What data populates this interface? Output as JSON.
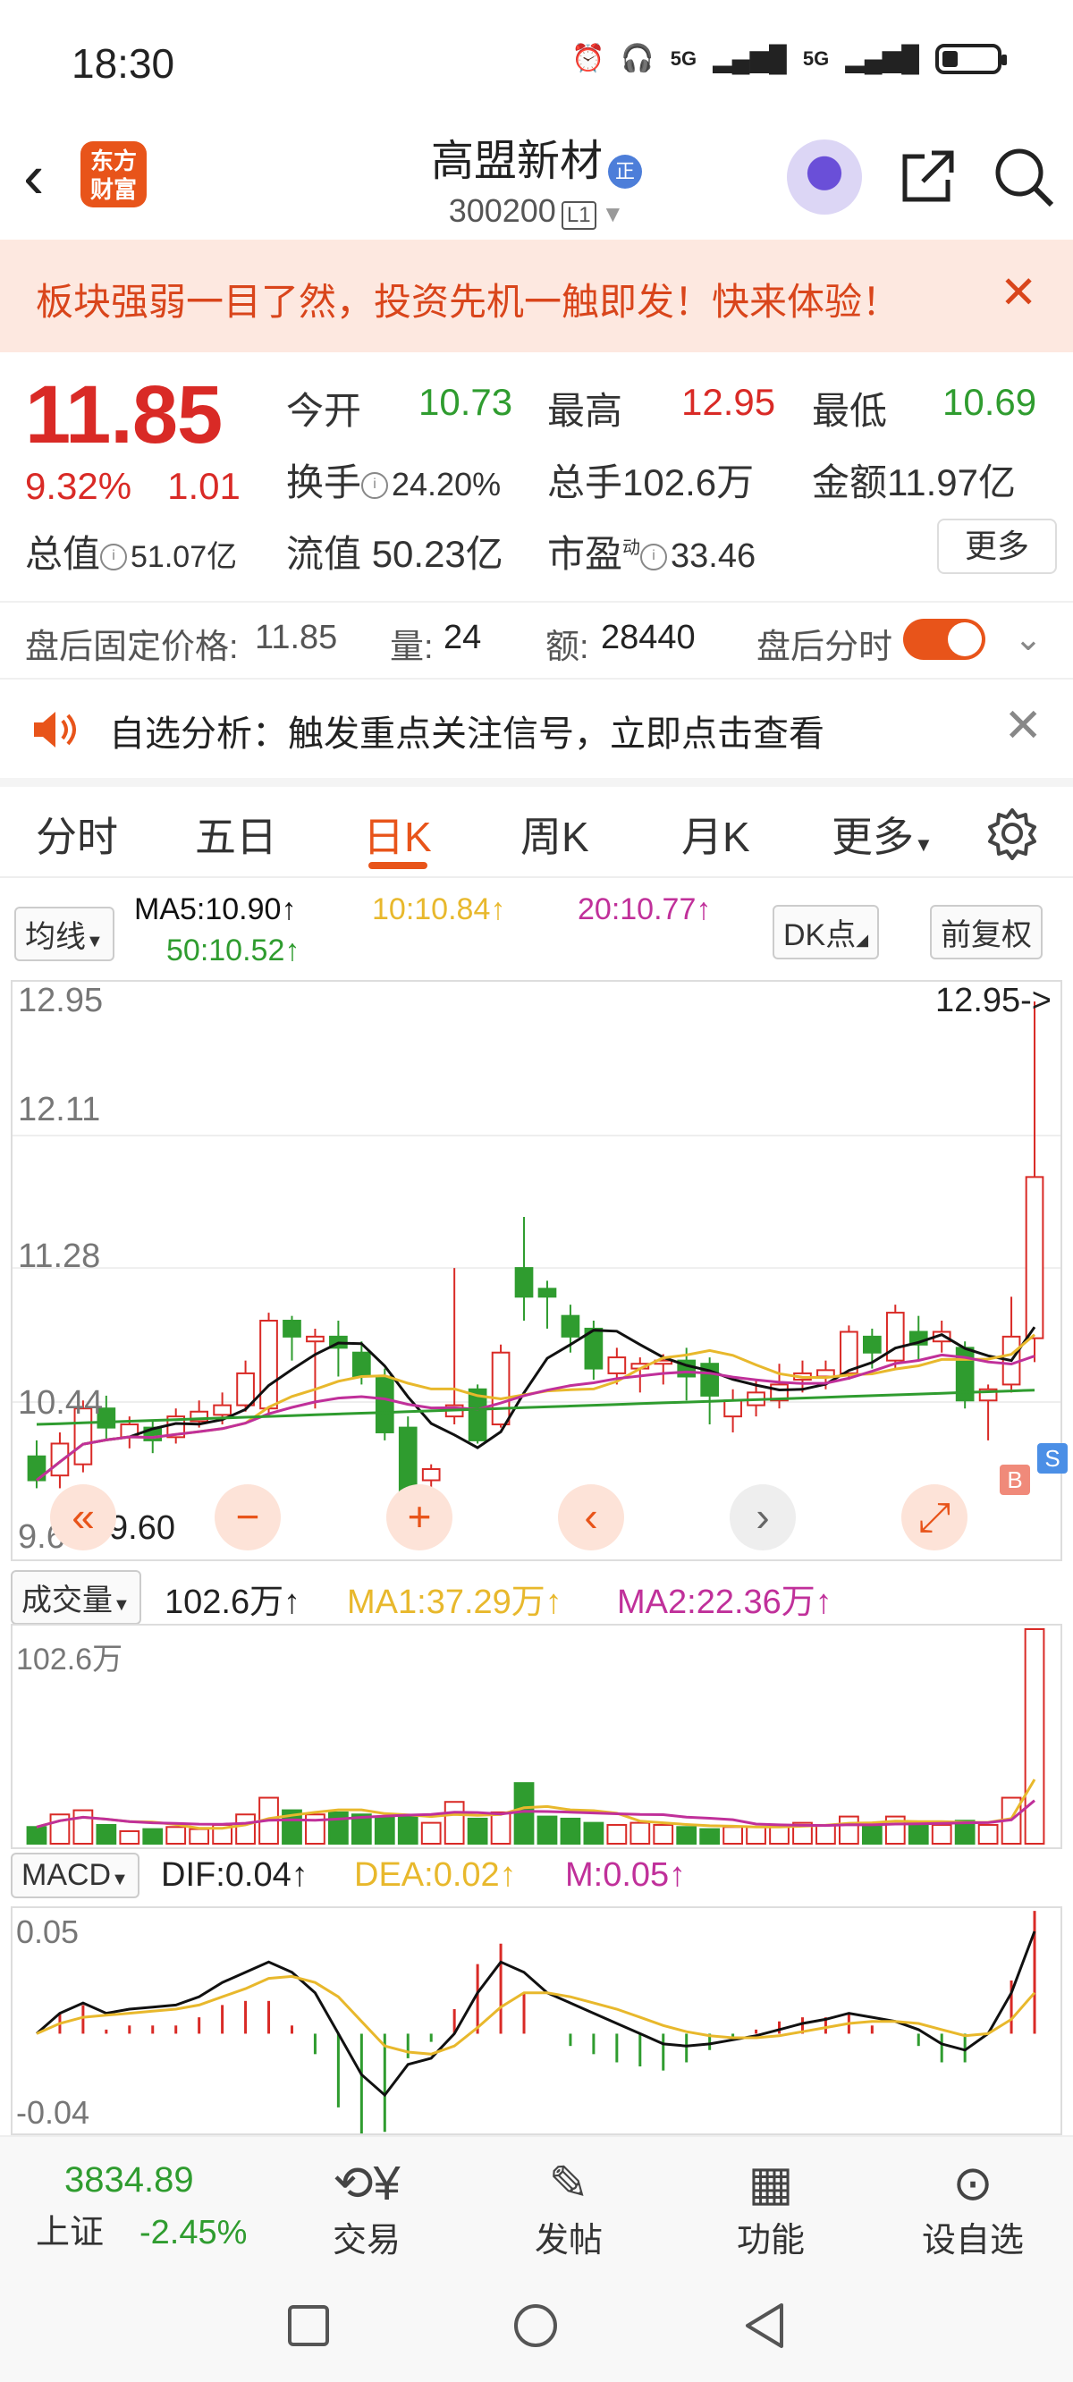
{
  "status_bar": {
    "time": "18:30",
    "signal1": "5G",
    "signal2": "5G",
    "battery_level": 0.25
  },
  "header": {
    "logo_line1": "东方",
    "logo_line2": "财富",
    "stock_name": "高盟新材",
    "badge": "正",
    "stock_code": "300200",
    "level": "L1"
  },
  "banner": {
    "text": "板块强弱一目了然，投资先机一触即发！快来体验！",
    "close": "✕"
  },
  "quote": {
    "price": "11.85",
    "change_pct": "9.32%",
    "change": "1.01",
    "open_label": "今开",
    "open": "10.73",
    "high_label": "最高",
    "high": "12.95",
    "low_label": "最低",
    "low": "10.69",
    "turnover_label": "换手",
    "turnover": "24.20%",
    "volume_label": "总手",
    "volume": "102.6万",
    "amount_label": "金额",
    "amount": "11.97亿",
    "mktcap_label": "总值",
    "mktcap": "51.07亿",
    "float_label": "流值",
    "float_cap": "50.23亿",
    "pe_label": "市盈",
    "pe_sup": "动",
    "pe": "33.46",
    "more": "更多"
  },
  "after_hours": {
    "price_label": "盘后固定价格:",
    "price": "11.85",
    "vol_label": "量:",
    "vol": "24",
    "amt_label": "额:",
    "amt": "28440",
    "intraday_label": "盘后分时"
  },
  "alert": {
    "text": "自选分析：触发重点关注信号，立即点击查看"
  },
  "tabs": [
    "分时",
    "五日",
    "日K",
    "周K",
    "月K",
    "更多"
  ],
  "active_tab": "日K",
  "ma_legend": {
    "selector": "均线",
    "ma5": "MA5:10.90↑",
    "ma10": "10:10.84↑",
    "ma20": "20:10.77↑",
    "ma50": "50:10.52↑",
    "dk": "DK点",
    "adjust": "前复权"
  },
  "kline_axis": {
    "top": "12.95",
    "y2": "12.11",
    "y3": "11.28",
    "y4": "10.44",
    "bottom": "9.60",
    "max_marker": "12.95->",
    "min_marker": "9.60",
    "buy": "B",
    "sell": "S"
  },
  "volume_panel": {
    "selector": "成交量",
    "value": "102.6万↑",
    "ma1": "MA1:37.29万↑",
    "ma2": "MA2:22.36万↑",
    "axis_top": "102.6万"
  },
  "macd_panel": {
    "selector": "MACD",
    "dif": "DIF:0.04↑",
    "dea": "DEA:0.02↑",
    "m": "M:0.05↑",
    "axis_top": "0.05",
    "axis_bottom": "-0.04"
  },
  "bottom_bar": {
    "index_value": "3834.89",
    "index_name": "上证",
    "index_change": "-2.45%",
    "trade": "交易",
    "post": "发帖",
    "function": "功能",
    "add_watch": "设自选"
  },
  "colors": {
    "up": "#d92a26",
    "down": "#2f9c2f",
    "accent": "#e8541a",
    "ma5": "#111111",
    "ma10": "#e8b82c",
    "ma20": "#c0309a",
    "ma50": "#2f9c2f"
  },
  "chart_data": {
    "type": "candlestick",
    "ylim": [
      9.6,
      12.95
    ],
    "candles": [
      {
        "o": 10.1,
        "c": 9.95,
        "h": 10.2,
        "l": 9.9
      },
      {
        "o": 9.98,
        "c": 10.18,
        "h": 10.25,
        "l": 9.9
      },
      {
        "o": 10.05,
        "c": 10.4,
        "h": 10.45,
        "l": 10.0
      },
      {
        "o": 10.4,
        "c": 10.28,
        "h": 10.48,
        "l": 10.2
      },
      {
        "o": 10.22,
        "c": 10.3,
        "h": 10.35,
        "l": 10.15
      },
      {
        "o": 10.28,
        "c": 10.2,
        "h": 10.32,
        "l": 10.12
      },
      {
        "o": 10.22,
        "c": 10.35,
        "h": 10.4,
        "l": 10.18
      },
      {
        "o": 10.32,
        "c": 10.38,
        "h": 10.45,
        "l": 10.28
      },
      {
        "o": 10.36,
        "c": 10.42,
        "h": 10.5,
        "l": 10.3
      },
      {
        "o": 10.42,
        "c": 10.62,
        "h": 10.7,
        "l": 10.38
      },
      {
        "o": 10.4,
        "c": 10.95,
        "h": 11.0,
        "l": 10.35
      },
      {
        "o": 10.95,
        "c": 10.85,
        "h": 10.98,
        "l": 10.7
      },
      {
        "o": 10.82,
        "c": 10.85,
        "h": 10.9,
        "l": 10.4
      },
      {
        "o": 10.85,
        "c": 10.78,
        "h": 10.95,
        "l": 10.6
      },
      {
        "o": 10.75,
        "c": 10.6,
        "h": 10.82,
        "l": 10.55
      },
      {
        "o": 10.6,
        "c": 10.25,
        "h": 10.65,
        "l": 10.2
      },
      {
        "o": 10.28,
        "c": 9.88,
        "h": 10.35,
        "l": 9.7
      },
      {
        "o": 9.95,
        "c": 10.02,
        "h": 10.05,
        "l": 9.85
      },
      {
        "o": 10.35,
        "c": 10.42,
        "h": 11.28,
        "l": 10.3
      },
      {
        "o": 10.52,
        "c": 10.2,
        "h": 10.55,
        "l": 10.18
      },
      {
        "o": 10.3,
        "c": 10.75,
        "h": 10.8,
        "l": 10.28
      },
      {
        "o": 11.28,
        "c": 11.1,
        "h": 11.6,
        "l": 10.95
      },
      {
        "o": 11.15,
        "c": 11.1,
        "h": 11.2,
        "l": 10.9
      },
      {
        "o": 10.98,
        "c": 10.85,
        "h": 11.05,
        "l": 10.75
      },
      {
        "o": 10.9,
        "c": 10.65,
        "h": 10.95,
        "l": 10.58
      },
      {
        "o": 10.62,
        "c": 10.72,
        "h": 10.78,
        "l": 10.55
      },
      {
        "o": 10.65,
        "c": 10.68,
        "h": 10.72,
        "l": 10.5
      },
      {
        "o": 10.68,
        "c": 10.7,
        "h": 10.74,
        "l": 10.55
      },
      {
        "o": 10.7,
        "c": 10.6,
        "h": 10.78,
        "l": 10.45
      },
      {
        "o": 10.68,
        "c": 10.48,
        "h": 10.72,
        "l": 10.3
      },
      {
        "o": 10.35,
        "c": 10.45,
        "h": 10.52,
        "l": 10.25
      },
      {
        "o": 10.42,
        "c": 10.5,
        "h": 10.58,
        "l": 10.35
      },
      {
        "o": 10.45,
        "c": 10.55,
        "h": 10.68,
        "l": 10.4
      },
      {
        "o": 10.58,
        "c": 10.62,
        "h": 10.7,
        "l": 10.5
      },
      {
        "o": 10.6,
        "c": 10.64,
        "h": 10.7,
        "l": 10.52
      },
      {
        "o": 10.62,
        "c": 10.88,
        "h": 10.92,
        "l": 10.58
      },
      {
        "o": 10.85,
        "c": 10.75,
        "h": 10.9,
        "l": 10.65
      },
      {
        "o": 10.7,
        "c": 11.0,
        "h": 11.05,
        "l": 10.65
      },
      {
        "o": 10.88,
        "c": 10.8,
        "h": 10.98,
        "l": 10.7
      },
      {
        "o": 10.82,
        "c": 10.88,
        "h": 10.95,
        "l": 10.75
      },
      {
        "o": 10.78,
        "c": 10.45,
        "h": 10.82,
        "l": 10.4
      },
      {
        "o": 10.45,
        "c": 10.52,
        "h": 10.55,
        "l": 10.2
      },
      {
        "o": 10.55,
        "c": 10.85,
        "h": 11.1,
        "l": 10.5
      },
      {
        "o": 10.84,
        "c": 11.85,
        "h": 12.95,
        "l": 10.69
      }
    ],
    "volume_max": 102.6,
    "volume": [
      8,
      14,
      16,
      9,
      6,
      7,
      8,
      7,
      9,
      14,
      22,
      16,
      14,
      15,
      14,
      13,
      13,
      10,
      20,
      12,
      15,
      29,
      13,
      12,
      10,
      9,
      10,
      9,
      8,
      7,
      8,
      8,
      9,
      10,
      9,
      13,
      9,
      13,
      9,
      9,
      11,
      9,
      22,
      102.6
    ],
    "macd_ylim": [
      -0.04,
      0.05
    ],
    "macd_dif": [
      0.0,
      0.01,
      0.015,
      0.01,
      0.012,
      0.013,
      0.014,
      0.018,
      0.025,
      0.03,
      0.035,
      0.03,
      0.02,
      0.0,
      -0.02,
      -0.03,
      -0.015,
      -0.012,
      0.0,
      0.02,
      0.035,
      0.03,
      0.02,
      0.015,
      0.01,
      0.005,
      0.0,
      -0.005,
      -0.006,
      -0.005,
      -0.003,
      -0.001,
      0.002,
      0.005,
      0.007,
      0.01,
      0.008,
      0.006,
      0.002,
      -0.005,
      -0.008,
      0.0,
      0.02,
      0.05
    ],
    "macd_dea": [
      0.0,
      0.005,
      0.008,
      0.009,
      0.01,
      0.011,
      0.012,
      0.014,
      0.018,
      0.022,
      0.027,
      0.028,
      0.025,
      0.018,
      0.006,
      -0.006,
      -0.009,
      -0.01,
      -0.006,
      0.003,
      0.013,
      0.02,
      0.02,
      0.018,
      0.015,
      0.012,
      0.008,
      0.004,
      0.001,
      -0.001,
      -0.002,
      -0.002,
      -0.001,
      0.001,
      0.003,
      0.005,
      0.006,
      0.006,
      0.005,
      0.002,
      -0.001,
      0.0,
      0.007,
      0.02
    ]
  }
}
